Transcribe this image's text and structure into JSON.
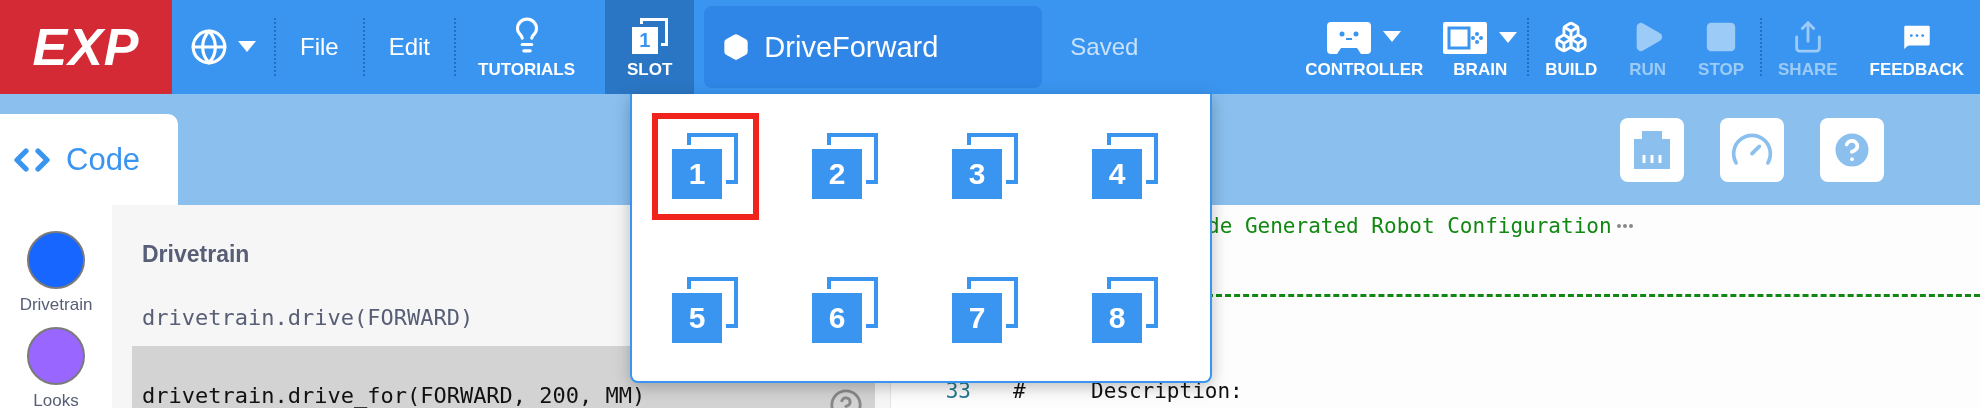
{
  "toolbar": {
    "logo": "EXP",
    "menus": [
      {
        "label": "File"
      },
      {
        "label": "Edit"
      }
    ],
    "tutorials": "TUTORIALS",
    "slot": {
      "label": "SLOT",
      "number": "1",
      "expanded": true
    },
    "project_name": "DriveForward",
    "save_status": "Saved",
    "actions": [
      {
        "label": "CONTROLLER",
        "kind": "controller",
        "disabled": false,
        "dropdown": true
      },
      {
        "label": "BRAIN",
        "kind": "brain",
        "disabled": false,
        "dropdown": true
      },
      {
        "label": "BUILD",
        "kind": "build",
        "disabled": false,
        "dropdown": false
      },
      {
        "label": "RUN",
        "kind": "run",
        "disabled": true,
        "dropdown": false
      },
      {
        "label": "STOP",
        "kind": "stop",
        "disabled": true,
        "dropdown": false
      },
      {
        "label": "SHARE",
        "kind": "share",
        "disabled": true,
        "dropdown": false
      },
      {
        "label": "FEEDBACK",
        "kind": "feedback",
        "disabled": false,
        "dropdown": false
      }
    ]
  },
  "slot_menu": {
    "slots": [
      {
        "number": "1",
        "selected": true
      },
      {
        "number": "2",
        "selected": false
      },
      {
        "number": "3",
        "selected": false
      },
      {
        "number": "4",
        "selected": false
      },
      {
        "number": "5",
        "selected": false
      },
      {
        "number": "6",
        "selected": false
      },
      {
        "number": "7",
        "selected": false
      },
      {
        "number": "8",
        "selected": false
      }
    ]
  },
  "tabs": [
    {
      "label": "Code",
      "selected": true
    }
  ],
  "tab_tools": [
    {
      "kind": "devices"
    },
    {
      "kind": "dashboard"
    },
    {
      "kind": "help"
    }
  ],
  "categories": [
    {
      "label": "Drivetrain",
      "color": "#1766ff"
    },
    {
      "label": "Looks",
      "color": "#9966ff"
    }
  ],
  "palette": {
    "heading": "Drivetrain",
    "commands": [
      {
        "text": "drivetrain.drive(FORWARD)",
        "selected": false
      },
      {
        "text": "drivetrain.drive_for(FORWARD, 200, MM)",
        "selected": true
      }
    ]
  },
  "editor": {
    "lines": [
      {
        "kind": "comment",
        "text": "de Generated Robot Configuration",
        "folded": true
      },
      {
        "kind": "rule"
      },
      {
        "kind": "code",
        "number": "33",
        "marker": "#",
        "text": "Description:"
      }
    ]
  }
}
